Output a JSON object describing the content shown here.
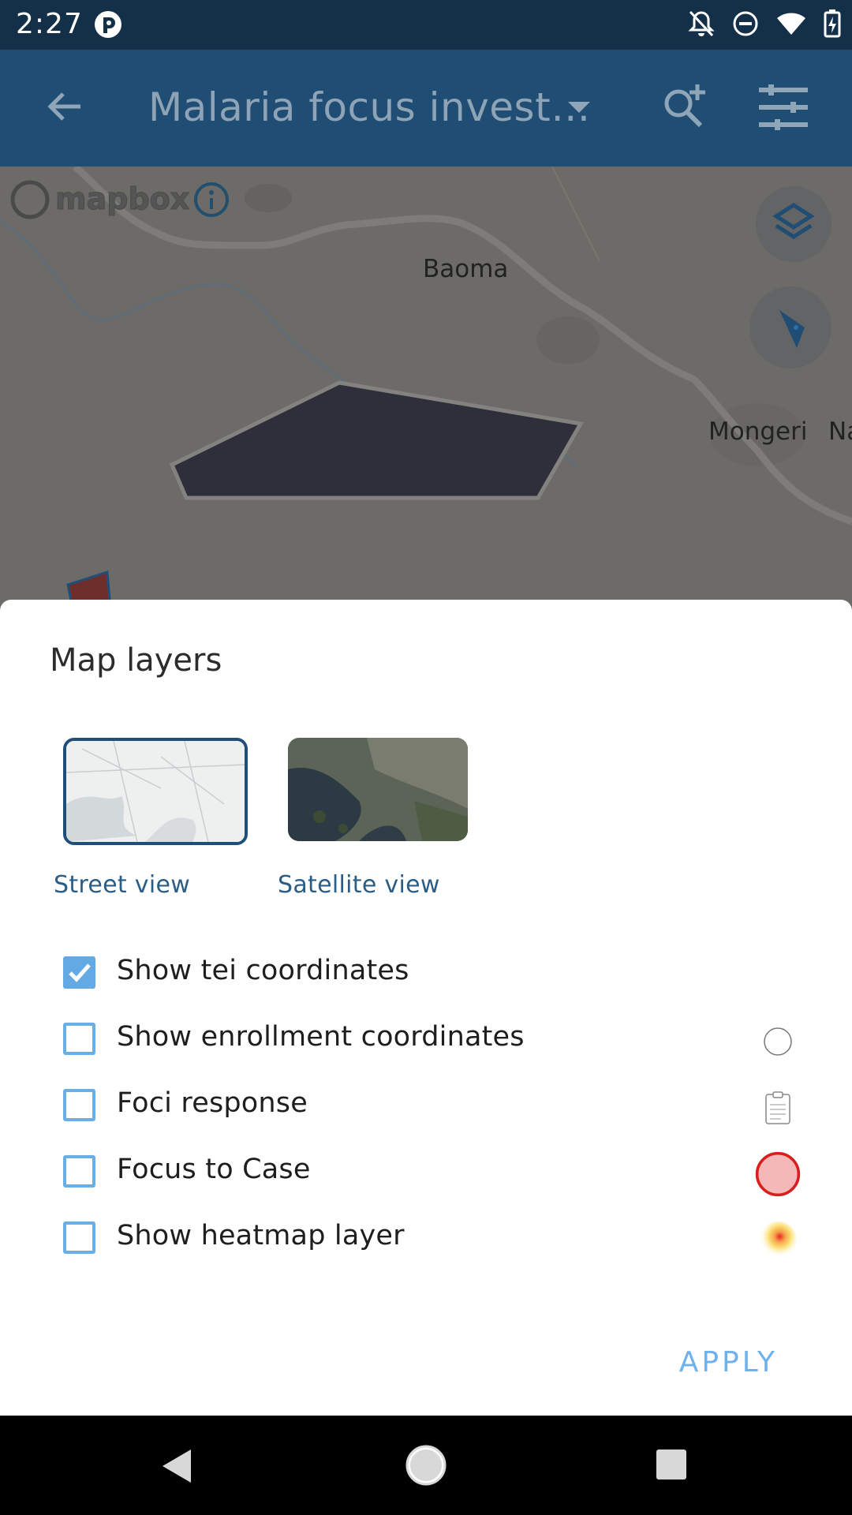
{
  "status_bar": {
    "time": "2:27",
    "icons": [
      "app-notification-icon",
      "notifications-off-icon",
      "do-not-disturb-icon",
      "wifi-icon",
      "battery-charging-icon"
    ]
  },
  "app_bar": {
    "title": "Malaria focus invest…",
    "back_icon": "arrow-back-icon",
    "dropdown_icon": "dropdown-arrow-icon",
    "search_icon": "search-add-icon",
    "filter_icon": "filter-icon"
  },
  "map": {
    "attribution": "mapbox",
    "labels": {
      "baoma": "Baoma",
      "mongeri": "Mongeri",
      "partial": "Na"
    }
  },
  "sheet": {
    "title": "Map layers",
    "base_maps": [
      {
        "label": "Street view",
        "selected": true
      },
      {
        "label": "Satellite view",
        "selected": false
      }
    ],
    "layers": [
      {
        "label": "Show tei coordinates",
        "checked": true,
        "icon": ""
      },
      {
        "label": "Show enrollment coordinates",
        "checked": false,
        "icon": "empty-circle-icon"
      },
      {
        "label": "Foci response",
        "checked": false,
        "icon": "clipboard-icon"
      },
      {
        "label": "Focus to Case",
        "checked": false,
        "icon": "red-circle-icon"
      },
      {
        "label": "Show heatmap layer",
        "checked": false,
        "icon": "heatmap-icon"
      }
    ],
    "apply_label": "APPLY"
  },
  "colors": {
    "status_bar": "#143049",
    "app_bar": "#204d73",
    "accent": "#63aae5",
    "link": "#2b5d85"
  },
  "nav_bar": {
    "icons": [
      "back-triangle-icon",
      "home-circle-icon",
      "recents-square-icon"
    ]
  }
}
